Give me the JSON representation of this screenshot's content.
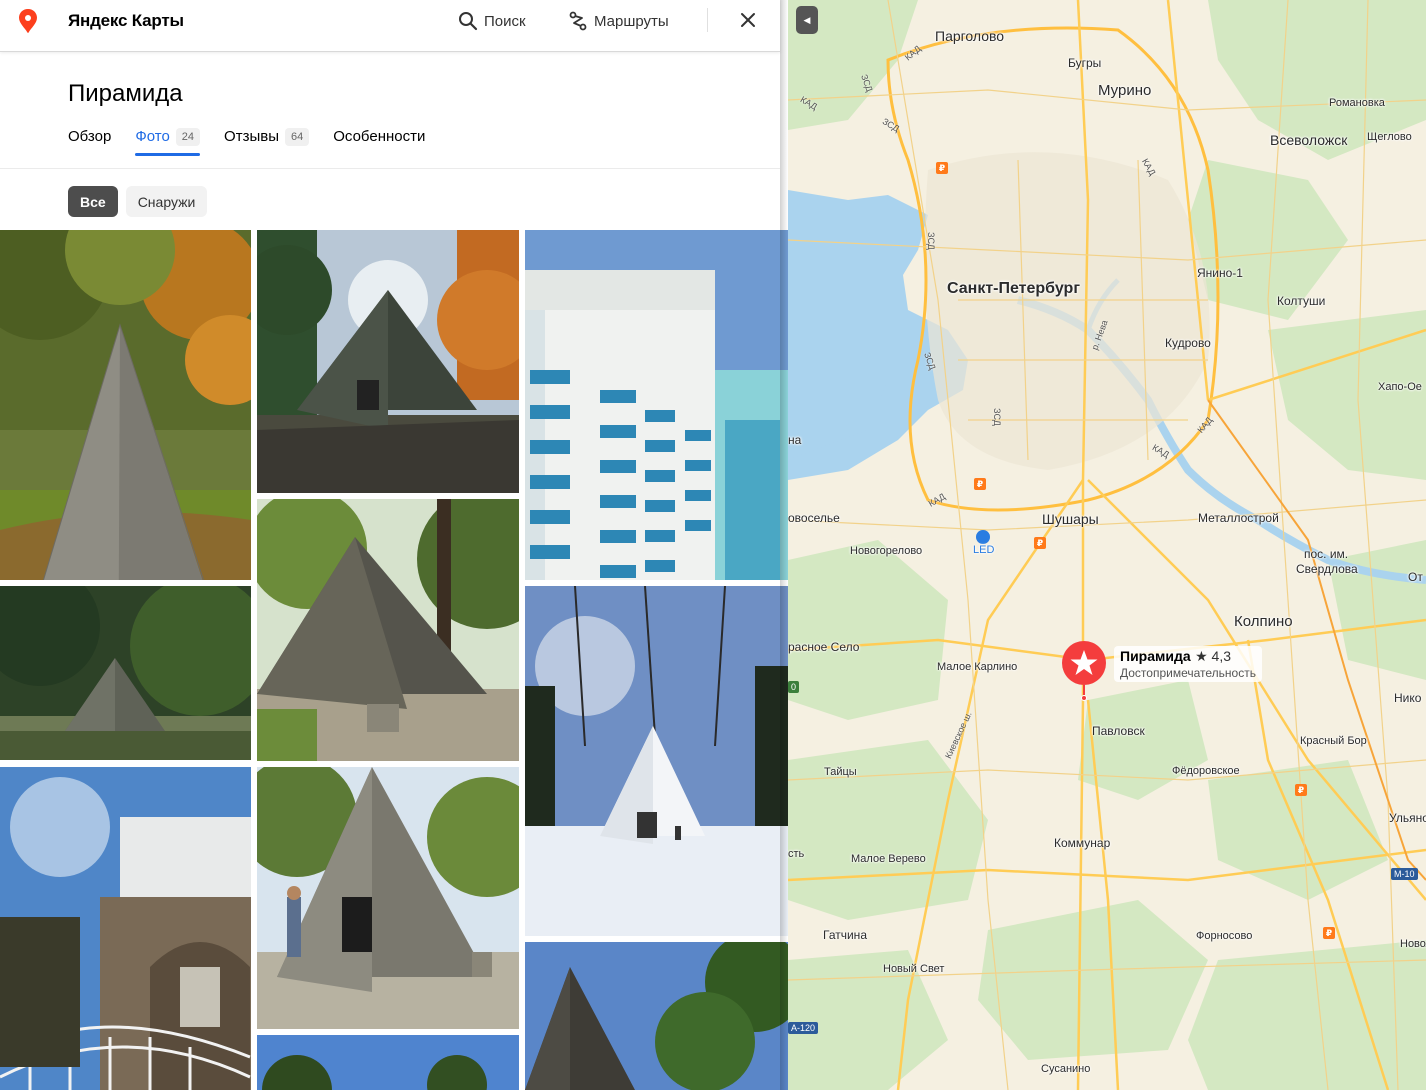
{
  "app": {
    "title": "Яндекс Карты"
  },
  "header": {
    "search_label": "Поиск",
    "routes_label": "Маршруты"
  },
  "place": {
    "name": "Пирамида"
  },
  "tabs": [
    {
      "label": "Обзор",
      "count": ""
    },
    {
      "label": "Фото",
      "count": "24"
    },
    {
      "label": "Отзывы",
      "count": "64"
    },
    {
      "label": "Особенности",
      "count": ""
    }
  ],
  "active_tab": "Фото",
  "photo_filters": [
    {
      "label": "Все"
    },
    {
      "label": "Снаружи"
    }
  ],
  "active_filter": "Все",
  "photos": [
    {
      "subject": "pyramid-autumn"
    },
    {
      "subject": "pyramid-sunburst-trees"
    },
    {
      "subject": "palace-blue-columns"
    },
    {
      "subject": "pyramid-distant-park"
    },
    {
      "subject": "pyramid-summer-side"
    },
    {
      "subject": "pyramid-winter-snow"
    },
    {
      "subject": "cameron-gallery-ramp"
    },
    {
      "subject": "pyramid-with-visitor"
    },
    {
      "subject": "pyramid-trees-partial"
    },
    {
      "subject": "blue-sky-partial"
    }
  ],
  "map": {
    "marker": {
      "name": "Пирамида",
      "rating": "★ 4,3",
      "category": "Достопримечательность"
    },
    "labels": {
      "pargolovo": "Парголово",
      "bugry": "Бугры",
      "murino": "Мурино",
      "romanovka": "Романовка",
      "vsevolozhsk": "Всеволожск",
      "shcheglovo": "Щеглово",
      "spb": "Санкт-Петербург",
      "yanino": "Янино-1",
      "koltushi": "Колтуши",
      "kudrovo": "Кудрово",
      "khapo": "Хапо-Ое",
      "neva": "р. Нева",
      "na": "на",
      "novoselye": "овоселье",
      "novogorelovo": "Новогорелово",
      "led": "LED",
      "shushary": "Шушары",
      "metallostroy": "Металлострой",
      "sverdlova1": "пос. им.",
      "sverdlova2": "Свердлова",
      "ot": "От",
      "kolpino": "Колпино",
      "krasnoe_selo": "расное Село",
      "maloe_karlino": "Малое Карлино",
      "kievskoe": "Киевское ш.",
      "pavlovsk": "Павловск",
      "niko": "Нико",
      "krasny_bor": "Красный Бор",
      "taitsy": "Тайцы",
      "fedorovskoe": "Фёдоровское",
      "ulyanovka": "Ульянов",
      "st": "сть",
      "kommunar": "Коммунар",
      "maloe_verevo": "Малое Верево",
      "m10": "М-10",
      "gatchina": "Гатчина",
      "fornosovo": "Форносово",
      "novolisino": "Новолі",
      "novy_svet": "Новый Свет",
      "a120": "А-120",
      "susanino": "Сусанино",
      "kad": "КАД",
      "zsd": "ЗСД",
      "green0": "0"
    }
  }
}
